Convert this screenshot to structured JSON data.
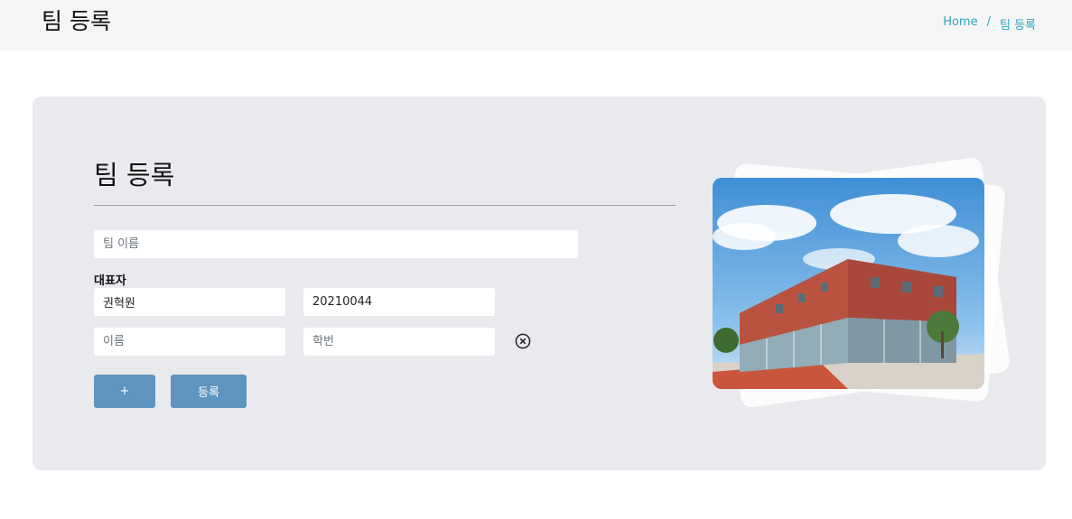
{
  "header": {
    "title": "팀 등록",
    "breadcrumb": {
      "home": "Home",
      "separator": "/",
      "current": "팀 등록"
    }
  },
  "form": {
    "title": "팀 등록",
    "team_name_placeholder": "팀 이름",
    "leader_label": "대표자",
    "leader_name_value": "권혁원",
    "leader_id_value": "20210044",
    "member_name_placeholder": "이름",
    "member_id_placeholder": "학번",
    "add_label": "+",
    "submit_label": "등록"
  },
  "colors": {
    "accent": "#5f94bf",
    "breadcrumb": "#2da7b8",
    "card_bg": "#e9eaed"
  },
  "image": {
    "subject": "campus-building-photo"
  }
}
